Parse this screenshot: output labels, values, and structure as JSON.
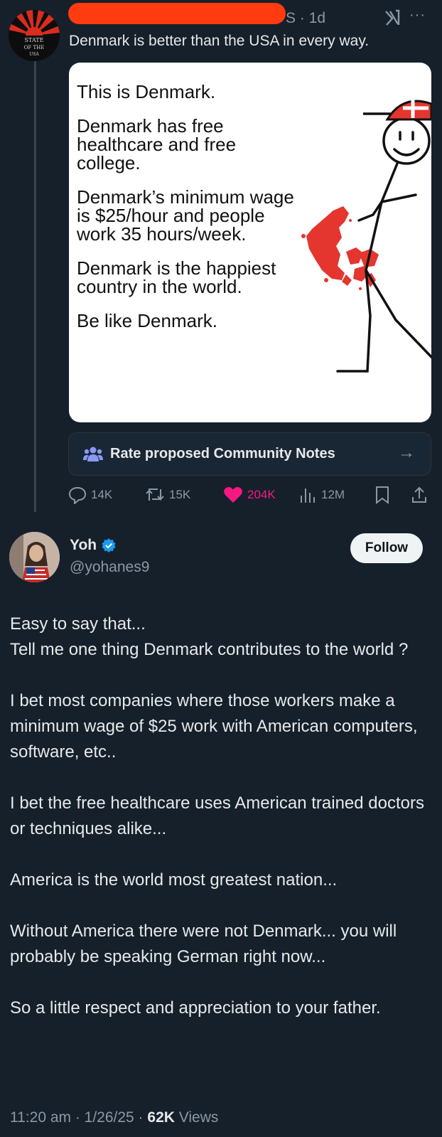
{
  "tweet1": {
    "handle_tail": "S · 1d",
    "text": "Denmark is better than the USA in every way.",
    "avatar_text": [
      "STATE",
      "OF THE",
      "USA"
    ],
    "meme": {
      "lines": [
        "This is Denmark.",
        "Denmark has free healthcare and free college.",
        "Denmark’s minimum wage is $25/hour and people work 35 hours/week.",
        "Denmark is the happiest country in the world.",
        "Be like Denmark."
      ]
    },
    "community_notes_label": "Rate proposed Community Notes",
    "actions": {
      "replies": "14K",
      "reposts": "15K",
      "likes": "204K",
      "views": "12M"
    }
  },
  "tweet2": {
    "name": "Yoh",
    "handle": "@yohanes9",
    "follow_label": "Follow",
    "paragraphs": [
      "Easy to say that...\nTell me one thing Denmark contributes to the world ?",
      "I bet most companies where those workers make a minimum wage of $25 work with American computers, software, etc..",
      "I bet the free healthcare uses American trained doctors or techniques alike...",
      "America is the world most greatest nation...",
      "Without America there were not Denmark... you will probably be speaking German right now...",
      "So a little respect and appreciation to your father."
    ],
    "time": "11:20 am · 1/26/25 · ",
    "views_count": "62K",
    "views_label": " Views"
  },
  "colors": {
    "background": "#15202b",
    "text": "#e7e9ea",
    "muted": "#8b98a5",
    "like": "#f91880",
    "verified": "#1d9bf0",
    "community_notes": "#8b98f5",
    "redaction": "#ff3b0f",
    "denmark_red": "#e4352f"
  },
  "icons": [
    "reply-icon",
    "repost-icon",
    "like-icon",
    "views-icon",
    "bookmark-icon",
    "share-icon",
    "community-notes-icon",
    "verified-badge-icon",
    "more-icon",
    "grok-icon",
    "arrow-right-icon"
  ]
}
